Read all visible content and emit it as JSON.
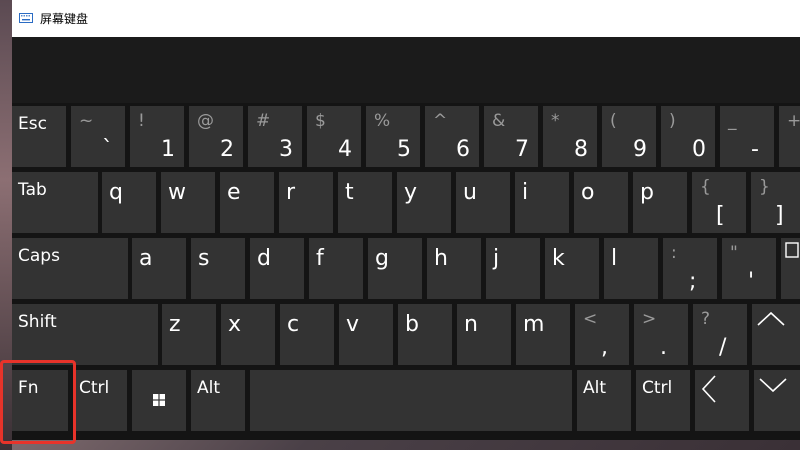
{
  "window": {
    "title": "屏幕键盘",
    "icon": "keyboard-icon"
  },
  "rows": {
    "row1": [
      {
        "name": "key-esc",
        "label": "Esc"
      },
      {
        "name": "key-backtick",
        "upper": "~",
        "lower": "`"
      },
      {
        "name": "key-1",
        "upper": "!",
        "lower": "1"
      },
      {
        "name": "key-2",
        "upper": "@",
        "lower": "2"
      },
      {
        "name": "key-3",
        "upper": "#",
        "lower": "3"
      },
      {
        "name": "key-4",
        "upper": "$",
        "lower": "4"
      },
      {
        "name": "key-5",
        "upper": "%",
        "lower": "5"
      },
      {
        "name": "key-6",
        "upper": "^",
        "lower": "6"
      },
      {
        "name": "key-7",
        "upper": "&",
        "lower": "7"
      },
      {
        "name": "key-8",
        "upper": "*",
        "lower": "8"
      },
      {
        "name": "key-9",
        "upper": "(",
        "lower": "9"
      },
      {
        "name": "key-0",
        "upper": ")",
        "lower": "0"
      },
      {
        "name": "key-minus",
        "upper": "_",
        "lower": "-"
      },
      {
        "name": "key-equals-partial",
        "upper": "+",
        "lower": ""
      }
    ],
    "row2": [
      {
        "name": "key-tab",
        "label": "Tab"
      },
      {
        "name": "key-q",
        "letter": "q"
      },
      {
        "name": "key-w",
        "letter": "w"
      },
      {
        "name": "key-e",
        "letter": "e"
      },
      {
        "name": "key-r",
        "letter": "r"
      },
      {
        "name": "key-t",
        "letter": "t"
      },
      {
        "name": "key-y",
        "letter": "y"
      },
      {
        "name": "key-u",
        "letter": "u"
      },
      {
        "name": "key-i",
        "letter": "i"
      },
      {
        "name": "key-o",
        "letter": "o"
      },
      {
        "name": "key-p",
        "letter": "p"
      },
      {
        "name": "key-open-bracket",
        "upper": "{",
        "lower": "["
      },
      {
        "name": "key-close-bracket",
        "upper": "}",
        "lower": "]"
      }
    ],
    "row3": [
      {
        "name": "key-caps",
        "label": "Caps"
      },
      {
        "name": "key-a",
        "letter": "a"
      },
      {
        "name": "key-s",
        "letter": "s"
      },
      {
        "name": "key-d",
        "letter": "d"
      },
      {
        "name": "key-f",
        "letter": "f"
      },
      {
        "name": "key-g",
        "letter": "g"
      },
      {
        "name": "key-h",
        "letter": "h"
      },
      {
        "name": "key-j",
        "letter": "j"
      },
      {
        "name": "key-k",
        "letter": "k"
      },
      {
        "name": "key-l",
        "letter": "l"
      },
      {
        "name": "key-semicolon",
        "upper": ":",
        "lower": ";"
      },
      {
        "name": "key-quote",
        "upper": "\"",
        "lower": "'"
      },
      {
        "name": "key-enter-partial",
        "icon": "enter-icon"
      }
    ],
    "row4": [
      {
        "name": "key-shift",
        "label": "Shift"
      },
      {
        "name": "key-z",
        "letter": "z"
      },
      {
        "name": "key-x",
        "letter": "x"
      },
      {
        "name": "key-c",
        "letter": "c"
      },
      {
        "name": "key-v",
        "letter": "v"
      },
      {
        "name": "key-b",
        "letter": "b"
      },
      {
        "name": "key-n",
        "letter": "n"
      },
      {
        "name": "key-m",
        "letter": "m"
      },
      {
        "name": "key-comma",
        "upper": "<",
        "lower": ","
      },
      {
        "name": "key-period",
        "upper": ">",
        "lower": "."
      },
      {
        "name": "key-slash",
        "upper": "?",
        "lower": "/"
      },
      {
        "name": "key-up-arrow",
        "icon": "chevron-up-icon"
      }
    ],
    "row5": [
      {
        "name": "key-fn",
        "label": "Fn"
      },
      {
        "name": "key-ctrl-left",
        "label": "Ctrl"
      },
      {
        "name": "key-windows",
        "icon": "windows-icon"
      },
      {
        "name": "key-alt-left",
        "label": "Alt"
      },
      {
        "name": "key-space",
        "label": ""
      },
      {
        "name": "key-alt-right",
        "label": "Alt"
      },
      {
        "name": "key-ctrl-right",
        "label": "Ctrl"
      },
      {
        "name": "key-left-arrow",
        "icon": "chevron-left-icon"
      },
      {
        "name": "key-down-arrow",
        "icon": "chevron-down-icon"
      }
    ]
  },
  "highlight": {
    "target": "Fn",
    "color": "#e8332a"
  },
  "colors": {
    "key": "#333333",
    "keyboard_bg": "#141414",
    "top_band": "#1b1b1b",
    "secondary_text": "#9a9a9a"
  }
}
